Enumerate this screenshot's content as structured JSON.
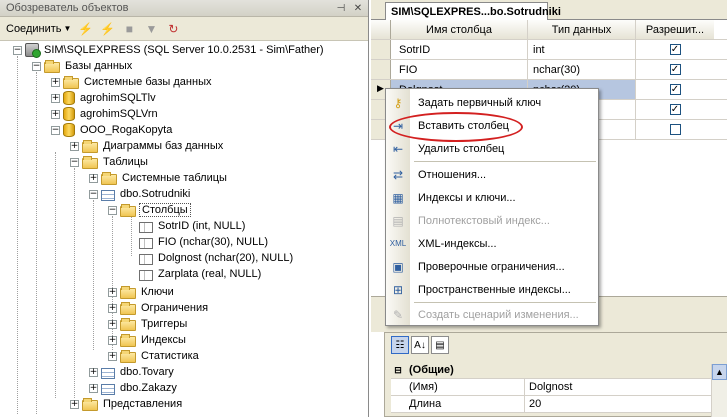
{
  "object_explorer": {
    "title": "Обозреватель объектов",
    "toolbar": {
      "connect_label": "Соединить"
    },
    "tree": [
      {
        "label": "SIM\\SQLEXPRESS (SQL Server 10.0.2531 - Sim\\Father)",
        "icon": "server-icon",
        "expander": "−"
      },
      {
        "label": "Базы данных",
        "icon": "folder-icon",
        "expander": "−"
      },
      {
        "label": "Системные базы данных",
        "icon": "folder-icon",
        "expander": "+"
      },
      {
        "label": "agrohimSQLTlv",
        "icon": "database-icon",
        "expander": "+"
      },
      {
        "label": "agrohimSQLVrn",
        "icon": "database-icon",
        "expander": "+"
      },
      {
        "label": "OOO_RogaKopyta",
        "icon": "database-icon",
        "expander": "−"
      },
      {
        "label": "Диаграммы баз данных",
        "icon": "folder-icon",
        "expander": "+"
      },
      {
        "label": "Таблицы",
        "icon": "folder-icon",
        "expander": "−"
      },
      {
        "label": "Системные таблицы",
        "icon": "folder-icon",
        "expander": "+"
      },
      {
        "label": "dbo.Sotrudniki",
        "icon": "table-icon",
        "expander": "−"
      },
      {
        "label": "Столбцы",
        "icon": "folder-icon",
        "expander": "−"
      },
      {
        "label": "SotrID (int, NULL)",
        "icon": "column-icon",
        "expander": ""
      },
      {
        "label": "FIO (nchar(30), NULL)",
        "icon": "column-icon",
        "expander": ""
      },
      {
        "label": "Dolgnost (nchar(20), NULL)",
        "icon": "column-icon",
        "expander": ""
      },
      {
        "label": "Zarplata (real, NULL)",
        "icon": "column-icon",
        "expander": ""
      },
      {
        "label": "Ключи",
        "icon": "folder-icon",
        "expander": "+"
      },
      {
        "label": "Ограничения",
        "icon": "folder-icon",
        "expander": "+"
      },
      {
        "label": "Триггеры",
        "icon": "folder-icon",
        "expander": "+"
      },
      {
        "label": "Индексы",
        "icon": "folder-icon",
        "expander": "+"
      },
      {
        "label": "Статистика",
        "icon": "folder-icon",
        "expander": "+"
      },
      {
        "label": "dbo.Tovary",
        "icon": "table-icon",
        "expander": "+"
      },
      {
        "label": "dbo.Zakazy",
        "icon": "table-icon",
        "expander": "+"
      },
      {
        "label": "Представления",
        "icon": "folder-icon",
        "expander": "+"
      }
    ]
  },
  "designer": {
    "tab_title": "SIM\\SQLEXPRES...bo.Sotrudniki",
    "grid": {
      "headers": [
        "Имя столбца",
        "Тип данных",
        "Разрешит..."
      ],
      "rows": [
        {
          "name": "SotrID",
          "type": "int",
          "allow_null": true
        },
        {
          "name": "FIO",
          "type": "nchar(30)",
          "allow_null": true
        },
        {
          "name": "Dolgnost",
          "type": "nchar(20)",
          "allow_null": true
        },
        {
          "name": "",
          "type": "",
          "allow_null": true
        },
        {
          "name": "",
          "type": "",
          "allow_null": false
        }
      ]
    },
    "properties": {
      "category": "(Общие)",
      "rows": [
        {
          "key": "(Имя)",
          "value": "Dolgnost"
        },
        {
          "key": "Длина",
          "value": "20"
        }
      ]
    }
  },
  "context_menu": {
    "items": [
      {
        "label": "Задать первичный ключ",
        "icon": "key-icon",
        "enabled": true
      },
      {
        "label": "Вставить столбец",
        "icon": "insert-column-icon",
        "enabled": true
      },
      {
        "label": "Удалить столбец",
        "icon": "delete-column-icon",
        "enabled": true
      },
      {
        "label": "Отношения...",
        "icon": "relationships-icon",
        "enabled": true
      },
      {
        "label": "Индексы и ключи...",
        "icon": "indexes-icon",
        "enabled": true
      },
      {
        "label": "Полнотекстовый индекс...",
        "icon": "fulltext-icon",
        "enabled": false
      },
      {
        "label": "XML-индексы...",
        "icon": "xml-icon",
        "enabled": true
      },
      {
        "label": "Проверочные ограничения...",
        "icon": "check-constraint-icon",
        "enabled": true
      },
      {
        "label": "Пространственные индексы...",
        "icon": "spatial-icon",
        "enabled": true
      },
      {
        "label": "Создать сценарий изменения...",
        "icon": "script-icon",
        "enabled": false
      }
    ]
  },
  "colors": {
    "highlight_ellipse": "#d32020",
    "selection_row": "#b6c6e0"
  }
}
